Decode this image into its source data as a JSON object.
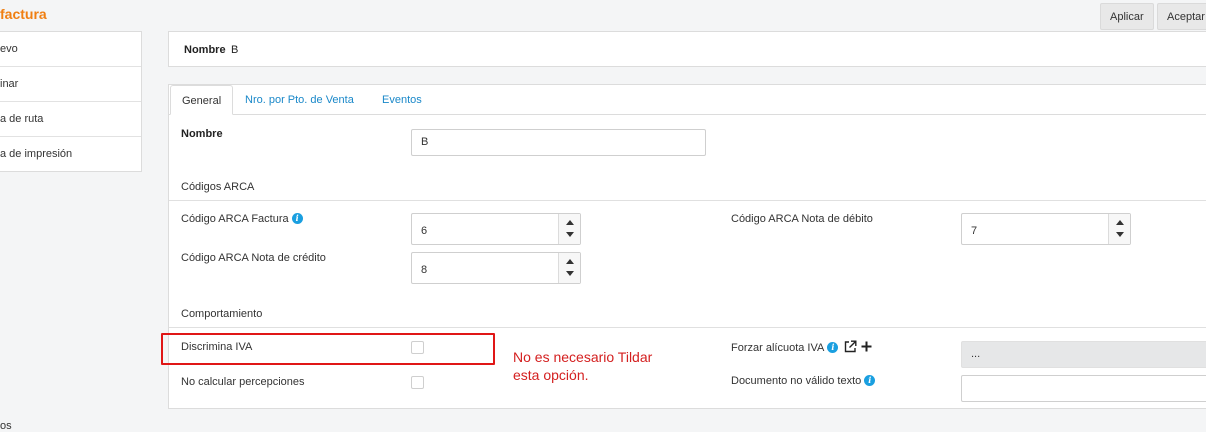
{
  "page": {
    "title": "factura",
    "buttons": {
      "apply": "Aplicar",
      "accept": "Aceptar"
    }
  },
  "side_menu": {
    "items": [
      {
        "label": "evo"
      },
      {
        "label": "inar"
      },
      {
        "label": "a de ruta"
      },
      {
        "label": "a de impresión"
      }
    ]
  },
  "header": {
    "label": "Nombre",
    "value": "B"
  },
  "tabs": [
    {
      "label": "General"
    },
    {
      "label": "Nro. por Pto. de Venta"
    },
    {
      "label": "Eventos"
    }
  ],
  "form": {
    "nombre": {
      "label": "Nombre",
      "value": "B"
    },
    "codigos_section": "Códigos ARCA",
    "codigo_factura": {
      "label": "Código ARCA Factura",
      "value": "6"
    },
    "codigo_nota_debito": {
      "label": "Código ARCA Nota de débito",
      "value": "7"
    },
    "codigo_nota_credito": {
      "label": "Código ARCA Nota de crédito",
      "value": "8"
    },
    "comportamiento_section": "Comportamiento",
    "discrimina_iva": {
      "label": "Discrimina IVA",
      "checked": false
    },
    "no_calcular": {
      "label": "No calcular percepciones",
      "checked": false
    },
    "forzar_alicuota": {
      "label": "Forzar alícuota IVA",
      "value": "..."
    },
    "documento_no_valido": {
      "label": "Documento no válido texto",
      "value": ""
    }
  },
  "annotation": {
    "note_line1": "No es necesario Tildar",
    "note_line2": "esta opción.",
    "color": "#e01616"
  },
  "bottom_fragment": "os",
  "icons": [
    "info-icon",
    "external-link-icon",
    "plus-icon",
    "chevron-up-icon",
    "chevron-down-icon"
  ],
  "colors": {
    "accent": "#f07f12",
    "link": "#1a88c9",
    "info": "#1a9fe0"
  }
}
